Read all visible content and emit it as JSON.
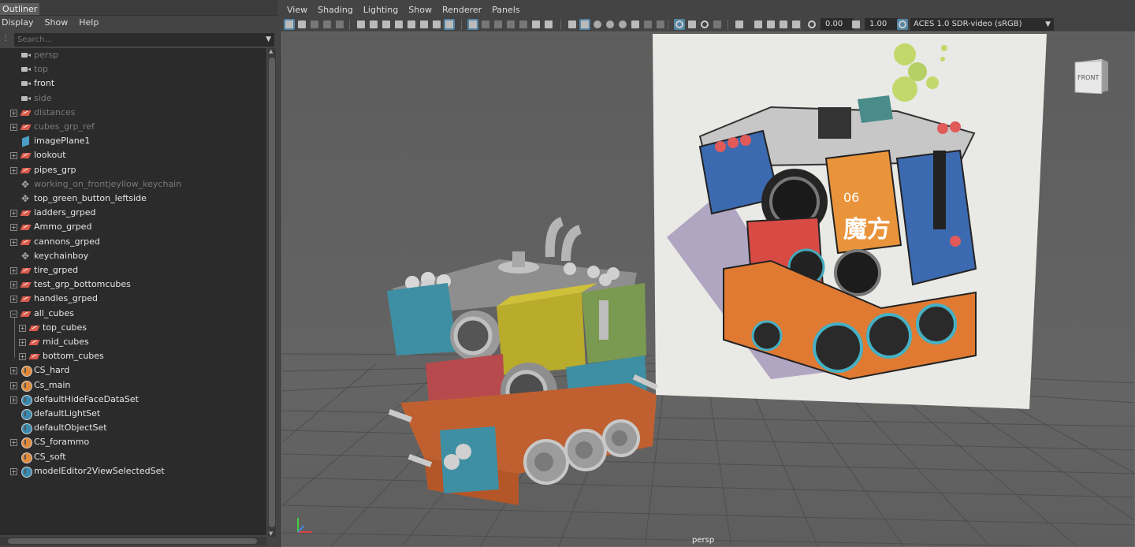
{
  "outliner": {
    "title": "Outliner",
    "menu": [
      "Display",
      "Show",
      "Help"
    ],
    "search_placeholder": "Search...",
    "nodes": [
      {
        "label": "persp",
        "icon": "camera-icon",
        "depth": 0,
        "expander": false,
        "dim": true
      },
      {
        "label": "top",
        "icon": "camera-icon",
        "depth": 0,
        "expander": false,
        "dim": true
      },
      {
        "label": "front",
        "icon": "camera-icon",
        "depth": 0,
        "expander": false,
        "dim": false
      },
      {
        "label": "side",
        "icon": "camera-icon",
        "depth": 0,
        "expander": false,
        "dim": true
      },
      {
        "label": "distances",
        "icon": "group-icon",
        "depth": 0,
        "expander": true,
        "dim": true
      },
      {
        "label": "cubes_grp_ref",
        "icon": "group-icon",
        "depth": 0,
        "expander": true,
        "dim": true
      },
      {
        "label": "imagePlane1",
        "icon": "image-plane-icon",
        "depth": 0,
        "expander": false,
        "dim": false
      },
      {
        "label": "lookout",
        "icon": "group-icon",
        "depth": 0,
        "expander": true,
        "dim": false
      },
      {
        "label": "pipes_grp",
        "icon": "group-icon",
        "depth": 0,
        "expander": true,
        "dim": false
      },
      {
        "label": "working_on_frontjeyllow_keychain",
        "icon": "locator-icon",
        "depth": 0,
        "expander": false,
        "dim": true
      },
      {
        "label": "top_green_button_leftside",
        "icon": "locator-icon",
        "depth": 0,
        "expander": false,
        "dim": false
      },
      {
        "label": "ladders_grped",
        "icon": "group-icon",
        "depth": 0,
        "expander": true,
        "dim": false
      },
      {
        "label": "Ammo_grped",
        "icon": "group-icon",
        "depth": 0,
        "expander": true,
        "dim": false
      },
      {
        "label": "cannons_grped",
        "icon": "group-icon",
        "depth": 0,
        "expander": true,
        "dim": false
      },
      {
        "label": "keychainboy",
        "icon": "locator-icon",
        "depth": 0,
        "expander": false,
        "dim": false
      },
      {
        "label": "tire_grped",
        "icon": "group-icon",
        "depth": 0,
        "expander": true,
        "dim": false
      },
      {
        "label": "test_grp_bottomcubes",
        "icon": "group-icon",
        "depth": 0,
        "expander": true,
        "dim": false
      },
      {
        "label": "handles_grped",
        "icon": "group-icon",
        "depth": 0,
        "expander": true,
        "dim": false
      },
      {
        "label": "all_cubes",
        "icon": "group-icon",
        "depth": 0,
        "expander": "open",
        "dim": false
      },
      {
        "label": "top_cubes",
        "icon": "group-icon",
        "depth": 1,
        "expander": true,
        "dim": false
      },
      {
        "label": "mid_cubes",
        "icon": "group-icon",
        "depth": 1,
        "expander": true,
        "dim": false
      },
      {
        "label": "bottom_cubes",
        "icon": "group-icon",
        "depth": 1,
        "expander": true,
        "dim": false
      },
      {
        "label": "CS_hard",
        "icon": "set-icon",
        "depth": 0,
        "expander": true,
        "dim": false
      },
      {
        "label": "Cs_main",
        "icon": "set-icon",
        "depth": 0,
        "expander": true,
        "dim": false
      },
      {
        "label": "defaultHideFaceDataSet",
        "icon": "default-set-icon",
        "depth": 0,
        "expander": true,
        "dim": false
      },
      {
        "label": "defaultLightSet",
        "icon": "default-set-icon",
        "depth": 0,
        "expander": false,
        "dim": false
      },
      {
        "label": "defaultObjectSet",
        "icon": "default-set-icon",
        "depth": 0,
        "expander": false,
        "dim": false
      },
      {
        "label": "CS_forammo",
        "icon": "set-icon",
        "depth": 0,
        "expander": true,
        "dim": false
      },
      {
        "label": "CS_soft",
        "icon": "set-icon",
        "depth": 0,
        "expander": false,
        "dim": false
      },
      {
        "label": "modelEditor2ViewSelectedSet",
        "icon": "default-set-icon",
        "depth": 0,
        "expander": true,
        "dim": false
      }
    ]
  },
  "viewport": {
    "menu": [
      "View",
      "Shading",
      "Lighting",
      "Show",
      "Renderer",
      "Panels"
    ],
    "exposure": "0.00",
    "gamma": "1.00",
    "color_transform": "ACES 1.0 SDR-video (sRGB)",
    "camera_label": "persp",
    "view_cube_label": "FRONT",
    "concept_glyphs": "魔方",
    "concept_number": "06",
    "concept_panel_number": "06"
  }
}
